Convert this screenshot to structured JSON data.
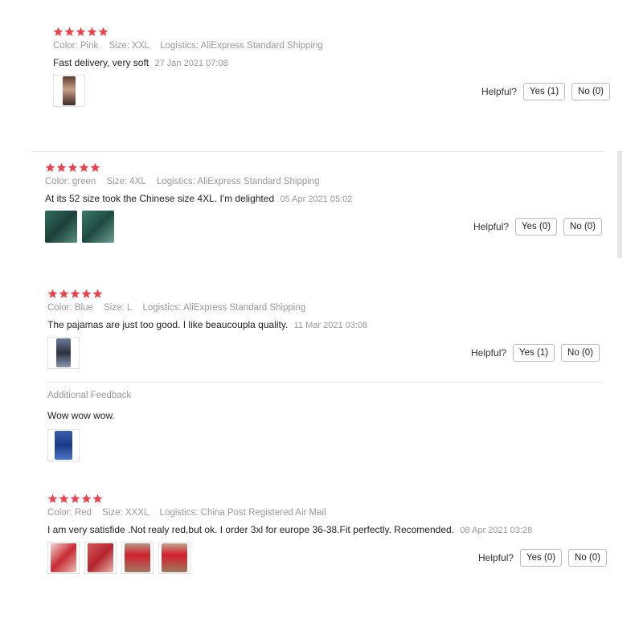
{
  "colors": {
    "star": "#e9444d",
    "meta": "#999999",
    "text": "#222222"
  },
  "helpful_label": "Helpful?",
  "reviews": [
    {
      "stars": 5,
      "color": "Color: Pink",
      "size": "Size: XXL",
      "logistics": "Logistics: AliExpress Standard Shipping",
      "text": "Fast delivery, very soft",
      "date": "27 Jan 2021 07:08",
      "yes": "Yes (1)",
      "no": "No (0)"
    },
    {
      "stars": 5,
      "color": "Color: green",
      "size": "Size: 4XL",
      "logistics": "Logistics: AliExpress Standard Shipping",
      "text": "At its 52 size took the Chinese size 4XL. I'm delighted",
      "date": "05 Apr 2021 05:02",
      "yes": "Yes (0)",
      "no": "No (0)"
    },
    {
      "stars": 5,
      "color": "Color: Blue",
      "size": "Size: L",
      "logistics": "Logistics: AliExpress Standard Shipping",
      "text": "The pajamas are just too good. I like beaucoupla quality.",
      "date": "11 Mar 2021 03:08",
      "yes": "Yes (1)",
      "no": "No (0)",
      "additional_title": "Additional Feedback",
      "additional_text": "Wow wow wow."
    },
    {
      "stars": 5,
      "color": "Color: Red",
      "size": "Size: XXXL",
      "logistics": "Logistics: China Post Registered Air Mail",
      "text": "I am very satisfide .Not realy red,but ok. I order 3xl for europe 36-38.Fit perfectly. Recomended.",
      "date": "08 Apr 2021 03:28",
      "yes": "Yes (0)",
      "no": "No (0)"
    }
  ]
}
